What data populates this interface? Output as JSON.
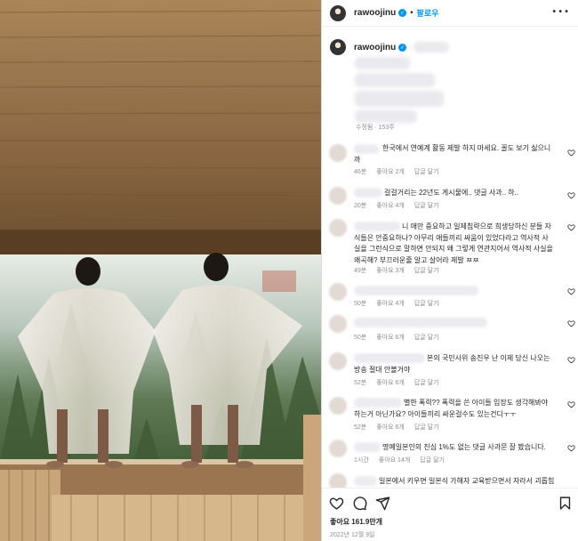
{
  "post": {
    "username": "rawoojinu",
    "verified_mark": "✓",
    "separator": "•",
    "follow_label": "팔로우",
    "more_label": "•••",
    "caption_time": "수정됨 · 153주",
    "likes": "좋아요 161.9만개",
    "date": "2022년 12월 9일"
  },
  "comments": [
    {
      "text": "한국에서 연예계 활동 제발 하지 마세요. 꼴도 보기 싫으니\n까",
      "time": "46분",
      "likes": "좋아요 2개",
      "reply": "답글 달기"
    },
    {
      "text": "걸걸거리는 22년도 게시물에.. 댓글 사과.. 하..",
      "time": "20분",
      "likes": "좋아요 4개",
      "reply": "답글 달기"
    },
    {
      "text": "니 애만 중요하고 일제침략으로 희생당하신 분들 자\n식들은 안중요하나? 아무리 애들끼리 싸움이 있었다라고 역사적 사\n실을 그런식으로 말하면 안되지 왜 그렇게 연관지어서 역사적 사실을\n왜곡해? 부끄러운줄 알고 살어라 제발 ㅉㅉ",
      "time": "49분",
      "likes": "좋아요 3개",
      "reply": "답글 달기"
    },
    {
      "text": "",
      "time": "50분",
      "likes": "좋아요 4개",
      "reply": "답글 달기"
    },
    {
      "text": "",
      "time": "50분",
      "likes": "좋아요 6개",
      "reply": "답글 달기"
    },
    {
      "text": "본의 국민사위 송진우 난 이제 당신 나오는\n방송 절대 안볼거야",
      "time": "52분",
      "likes": "좋아요 6개",
      "reply": "답글 달기"
    },
    {
      "text": "별한 폭력?? 폭력을 쓴 아이들 입장도 생각해봐야\n하는거 아닌가요? 아이들끼리 싸운걸수도 있는건디ㅜㅜ",
      "time": "52분",
      "likes": "좋아요 6개",
      "reply": "답글 달기"
    },
    {
      "text": "명예일본인의 진심 1%도 없는 댓글 사과문 잘 봤습니다.",
      "time": "1시간",
      "likes": "좋아요 14개",
      "reply": "답글 달기"
    },
    {
      "text": "일본에서 키우면 일본식 가해자 교육받으면서 자라서 괴롭힘",
      "time": "",
      "likes": "",
      "reply": ""
    }
  ],
  "icons": {
    "heart": "heart-icon",
    "comment": "comment-icon",
    "share": "share-icon",
    "save": "bookmark-icon",
    "more": "more-icon",
    "verified": "verified-badge-icon"
  },
  "colors": {
    "accent": "#0095f6",
    "text": "#262626",
    "muted": "#8e8e8e"
  }
}
